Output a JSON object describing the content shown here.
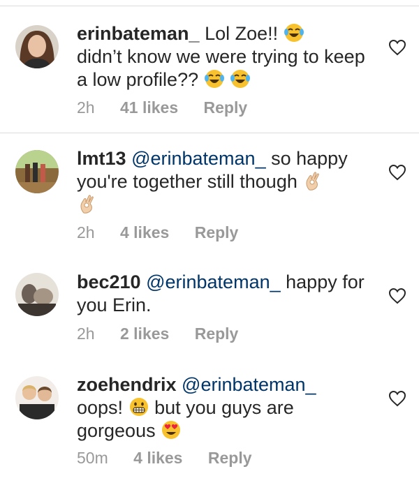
{
  "comments": [
    {
      "username": "erinbateman_",
      "mention": "",
      "text_1": "Lol Zoe!!",
      "text_2": "didn’t know we were trying to keep a low profile??",
      "time": "2h",
      "likes": "41 likes",
      "reply": "Reply",
      "emojis": [
        "face-with-tears-of-joy-emoji",
        "face-with-tears-of-joy-emoji",
        "face-with-tears-of-joy-emoji"
      ]
    },
    {
      "username": "lmt13",
      "mention": "@erinbateman_",
      "text_1": "so happy you're together still though",
      "time": "2h",
      "likes": "4 likes",
      "reply": "Reply",
      "emojis": [
        "ok-hand-emoji",
        "ok-hand-emoji"
      ]
    },
    {
      "username": "bec210",
      "mention": "@erinbateman_",
      "text_1": "happy for you Erin.",
      "time": "2h",
      "likes": "2 likes",
      "reply": "Reply",
      "emojis": []
    },
    {
      "username": "zoehendrix",
      "mention": "@erinbateman_",
      "text_1": "oops!",
      "text_2": "but you guys are gorgeous",
      "time": "50m",
      "likes": "4 likes",
      "reply": "Reply",
      "emojis": [
        "grimacing-face-emoji",
        "heart-eyes-emoji"
      ]
    }
  ],
  "colors": {
    "text": "#262626",
    "mention": "#003569",
    "meta": "#999999",
    "divider": "#dbdbdb",
    "emoji_yellow": "#f7c22e"
  },
  "icons": {
    "like": "heart-outline-icon"
  }
}
